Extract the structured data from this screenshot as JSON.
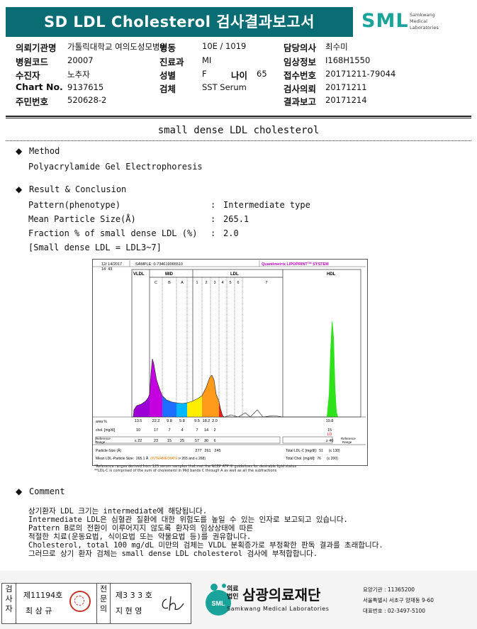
{
  "header": {
    "title": "SD LDL Cholesterol 검사결과보고서",
    "logo_text": "SML",
    "logo_sub": [
      "Samkwang",
      "Medical",
      "Laboratories"
    ],
    "fields": [
      {
        "label": "의뢰기관명",
        "value": "가톨릭대학교 여의도성모병원"
      },
      {
        "label": "병원코드",
        "value": "20007"
      },
      {
        "label": "수진자",
        "value": "노추자"
      },
      {
        "label": "Chart No.",
        "value": "9137615"
      },
      {
        "label": "주민번호",
        "value": "520628-2"
      },
      {
        "label": "병동",
        "value": "10E / 1019"
      },
      {
        "label": "진료과",
        "value": "MI"
      },
      {
        "label": "성별",
        "value": "F"
      },
      {
        "label": "나이",
        "value": "65"
      },
      {
        "label": "검체",
        "value": "SST Serum"
      },
      {
        "label": "담당의사",
        "value": "최수미"
      },
      {
        "label": "임상정보",
        "value": "I168H1550"
      },
      {
        "label": "접수번호",
        "value": "20171211-79044"
      },
      {
        "label": "검사의뢰",
        "value": "20171211"
      },
      {
        "label": "결과보고",
        "value": "20171214"
      }
    ]
  },
  "section": {
    "title": "small dense LDL cholesterol",
    "method_heading": "Method",
    "method_text": "Polyacrylamide Gel Electrophoresis",
    "result_heading": "Result & Conclusion",
    "results": [
      {
        "label": "Pattern(phenotype)",
        "value": "Intermediate type"
      },
      {
        "label": "Mean Particle Size(Å)",
        "value": "265.1"
      },
      {
        "label": "Fraction % of small dense LDL (%)",
        "value": "2.0"
      }
    ],
    "note": "[Small dense LDL = LDL3~7]",
    "colon": ":"
  },
  "chart_data": {
    "type": "area",
    "header_date": "12/ 14/2017",
    "header_time": "14: 43",
    "sample": "SAMPLE:    0-734619065510",
    "system": "Quantimetrix LIPOPRINT",
    "system_tm": "TM",
    "system_suffix": " SYSTEM",
    "band_groups": [
      "VLDL",
      "MID",
      "LDL",
      "HDL"
    ],
    "bands": [
      "C",
      "B",
      "A",
      "1",
      "2",
      "3",
      "4",
      "5",
      "6",
      "7"
    ],
    "area_label": "area %",
    "area_values": [
      "13.5",
      "22.2",
      "9.8",
      "5.8",
      "9.5",
      "18.2",
      "2.0"
    ],
    "area_hdl": "19.8",
    "chol_label": "chol. [mg/dl]",
    "chol_values": [
      "10",
      "17",
      "7",
      "4",
      "7",
      "14",
      "2"
    ],
    "chol_hdl": "15",
    "chol_hdl_flag": "LO",
    "ref_label": "Reference Range",
    "ref_values": [
      "≤ 22",
      "23",
      "15",
      "25",
      "57",
      "30",
      "6"
    ],
    "ref_hdl": "≥ 40",
    "particle_label": "Particle-Size (Å)",
    "particle_values": [
      "277",
      "261",
      "245"
    ],
    "mean_label": "Mean LDL-Particle Size:",
    "mean_value": "265.1 Å",
    "mean_type": "(INTERMEDIATE",
    "mean_range": ":> 265 and ≤ 268)",
    "total_ldl_label": "Total LDL-C [mg/dl]:",
    "total_ldl_value": "51",
    "total_ldl_ref": "(≤ 130)",
    "total_chol_label": "Total Chol. [mg/dl]:",
    "total_chol_value": "76",
    "total_chol_ref": "(≤ 200)",
    "ref_right_label": "Reference Range",
    "footnote1": "*Reference ranges derived from 125 serum samples that met the NCEP ATP III guidelines for desirable lipid status",
    "footnote2": "**LDL-C is comprised of the sum of cholesterol in Mid bands C through A as well as all the subfractions",
    "colors": {
      "vldl": "#9b00d6",
      "midC": "#c400e0",
      "midB": "#1e6fff",
      "midA": "#00b8ff",
      "ldl1": "#ffee00",
      "ldl2": "#ff9a1a",
      "ldl3": "#e8201e",
      "hdl": "#2ee21a"
    }
  },
  "comment": {
    "heading": "Comment",
    "lines": [
      "상기환자 LDL 크기는 intermediate에 해당됩니다.",
      "Intermediate LDL은 심혈관 질환에 대한 위험도를 높일 수 있는 인자로 보고되고 있습니다.",
      "Pattern B로의 전환이 이루어지지 않도록 환자의 임상상태에 따른",
      "적절한 치료(운동요법, 식이요법 또는 약물요법 등)를 권유합니다.",
      "Cholesterol, total 100 mg/dL 미만의 검체는 VLDL 분획증가로 부정확한 판독 결과를 초래합니다.",
      "그러므로 상기 환자 검체는 small dense LDL cholesterol 검사에 부적합합니다."
    ]
  },
  "footer": {
    "sign1_vertical": [
      "검",
      "사",
      "자"
    ],
    "sign1_no": "제11194호",
    "sign1_name": "최 삼 규",
    "sign2_vertical": [
      "전",
      "문",
      "의"
    ],
    "sign2_no": "제3 3 3 호",
    "sign2_name": "지 현 영",
    "org_prefix": [
      "의료",
      "법인"
    ],
    "org_name": "삼광의료재단",
    "org_en": "Samkwang Medical Laboratories",
    "org_info": [
      "요양기관 : 11365200",
      "서울특별시 서초구 양재동 9-60",
      "대표번호 : 02-3497-5100"
    ]
  }
}
